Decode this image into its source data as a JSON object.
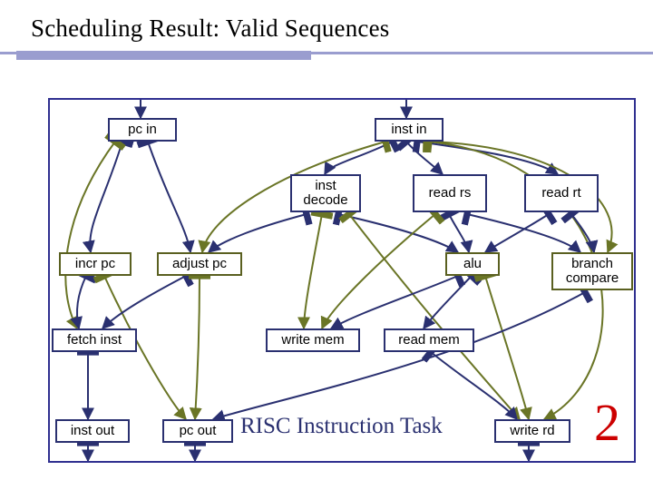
{
  "title": "Scheduling Result: Valid Sequences",
  "caption": "RISC Instruction Task",
  "bignum": "2",
  "nodes": {
    "pc_in": {
      "label": "pc in"
    },
    "inst_in": {
      "label": "inst in"
    },
    "inst_decode": {
      "line1": "inst",
      "line2": "decode"
    },
    "read_rs": {
      "label": "read rs"
    },
    "read_rt": {
      "label": "read rt"
    },
    "incr_pc": {
      "label": "incr pc"
    },
    "adjust_pc": {
      "label": "adjust pc"
    },
    "alu": {
      "label": "alu"
    },
    "branch_cmp": {
      "line1": "branch",
      "line2": "compare"
    },
    "fetch_inst": {
      "label": "fetch inst"
    },
    "write_mem": {
      "label": "write mem"
    },
    "read_mem": {
      "label": "read mem"
    },
    "inst_out": {
      "label": "inst out"
    },
    "pc_out": {
      "label": "pc out"
    },
    "write_rd": {
      "label": "write rd"
    }
  },
  "chart_data": {
    "type": "diagram",
    "title": "Scheduling Result: Valid Sequences",
    "annotation_counter": 2,
    "nodes": [
      {
        "id": "pc_in",
        "label": "pc in",
        "row": 0
      },
      {
        "id": "inst_in",
        "label": "inst in",
        "row": 0
      },
      {
        "id": "inst_decode",
        "label": "inst decode",
        "row": 1
      },
      {
        "id": "read_rs",
        "label": "read rs",
        "row": 1
      },
      {
        "id": "read_rt",
        "label": "read rt",
        "row": 1
      },
      {
        "id": "incr_pc",
        "label": "incr pc",
        "row": 2
      },
      {
        "id": "adjust_pc",
        "label": "adjust pc",
        "row": 2
      },
      {
        "id": "alu",
        "label": "alu",
        "row": 2
      },
      {
        "id": "branch_cmp",
        "label": "branch compare",
        "row": 2
      },
      {
        "id": "fetch_inst",
        "label": "fetch inst",
        "row": 3
      },
      {
        "id": "write_mem",
        "label": "write mem",
        "row": 3
      },
      {
        "id": "read_mem",
        "label": "read mem",
        "row": 3
      },
      {
        "id": "inst_out",
        "label": "inst out",
        "row": 4
      },
      {
        "id": "pc_out",
        "label": "pc out",
        "row": 4
      },
      {
        "id": "write_rd",
        "label": "write rd",
        "row": 4
      }
    ],
    "edges": [
      {
        "from": "pc_in",
        "to": "incr_pc"
      },
      {
        "from": "pc_in",
        "to": "adjust_pc"
      },
      {
        "from": "pc_in",
        "to": "fetch_inst"
      },
      {
        "from": "inst_in",
        "to": "inst_decode"
      },
      {
        "from": "inst_in",
        "to": "read_rs"
      },
      {
        "from": "inst_in",
        "to": "read_rt"
      },
      {
        "from": "inst_in",
        "to": "adjust_pc"
      },
      {
        "from": "inst_in",
        "to": "branch_cmp"
      },
      {
        "from": "inst_in",
        "to": "write_rd"
      },
      {
        "from": "inst_decode",
        "to": "adjust_pc"
      },
      {
        "from": "inst_decode",
        "to": "alu"
      },
      {
        "from": "inst_decode",
        "to": "write_mem"
      },
      {
        "from": "inst_decode",
        "to": "write_rd"
      },
      {
        "from": "read_rs",
        "to": "alu"
      },
      {
        "from": "read_rs",
        "to": "branch_cmp"
      },
      {
        "from": "read_rs",
        "to": "write_mem"
      },
      {
        "from": "read_rt",
        "to": "alu"
      },
      {
        "from": "read_rt",
        "to": "branch_cmp"
      },
      {
        "from": "incr_pc",
        "to": "fetch_inst"
      },
      {
        "from": "incr_pc",
        "to": "pc_out"
      },
      {
        "from": "adjust_pc",
        "to": "fetch_inst"
      },
      {
        "from": "adjust_pc",
        "to": "pc_out"
      },
      {
        "from": "alu",
        "to": "write_mem"
      },
      {
        "from": "alu",
        "to": "read_mem"
      },
      {
        "from": "alu",
        "to": "write_rd"
      },
      {
        "from": "branch_cmp",
        "to": "pc_out"
      },
      {
        "from": "fetch_inst",
        "to": "inst_out"
      },
      {
        "from": "read_mem",
        "to": "write_rd"
      }
    ]
  }
}
